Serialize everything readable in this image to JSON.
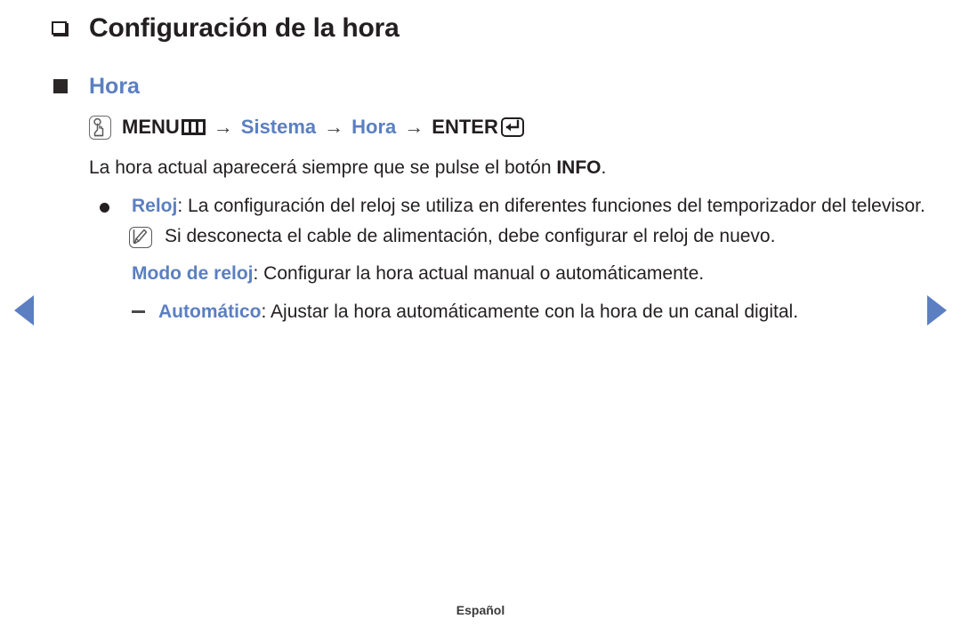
{
  "colors": {
    "accent_blue": "#5b7fc1",
    "text_dark": "#231f20",
    "background": "#ffffff"
  },
  "nav": {
    "prev_label": "◀",
    "next_label": "▶"
  },
  "title": "Configuración de la hora",
  "section": {
    "heading": "Hora"
  },
  "breadcrumb": {
    "menu": "MENU",
    "sep": "→",
    "item1": "Sistema",
    "item2": "Hora",
    "enter": "ENTER"
  },
  "body": {
    "info_line_pre": "La hora actual aparecerá siempre que se pulse el botón ",
    "info_keyword": "INFO",
    "info_line_post": "."
  },
  "items": [
    {
      "term": "Reloj",
      "separator": ": ",
      "text": "La configuración del reloj se utiliza en diferentes funciones del temporizador del televisor."
    }
  ],
  "note": {
    "text": "Si desconecta el cable de alimentación, debe configurar el reloj de nuevo."
  },
  "clock_mode": {
    "term": "Modo de reloj",
    "separator": ": ",
    "text": "Configurar la hora actual manual o automáticamente."
  },
  "sub_items": [
    {
      "term": "Automático",
      "separator": ": ",
      "text": "Ajustar la hora automáticamente con la hora de un canal digital."
    }
  ],
  "footer": {
    "language": "Español"
  }
}
